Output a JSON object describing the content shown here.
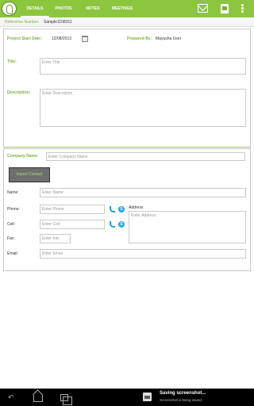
{
  "header": {
    "tabs": [
      {
        "label": "DETAILS",
        "active": true
      },
      {
        "label": "PHOTOS",
        "active": false
      },
      {
        "label": "NOTES",
        "active": false
      },
      {
        "label": "MEETINGS",
        "active": false
      }
    ],
    "icons": [
      "app-logo-icon",
      "mail-icon",
      "document-icon",
      "overflow-menu-icon"
    ]
  },
  "reference": {
    "label": "Reference Number:",
    "value": "Sample1108311"
  },
  "project": {
    "start_date_label": "Project Start Date:",
    "start_date_value": "12/08/2013",
    "prepared_by_label": "Prepared By:",
    "prepared_by_value": "Mayusha User",
    "title_label": "Title:",
    "title_placeholder": "Enter Title",
    "description_label": "Description:",
    "description_placeholder": "Enter Description"
  },
  "contact": {
    "company_label": "Company Name:",
    "company_placeholder": "Enter Company Name",
    "import_button": "Import Contact",
    "name_label": "Name:",
    "name_placeholder": "Enter Name",
    "phone_label": "Phone:",
    "phone_placeholder": "Enter Phone",
    "cell_label": "Cell:",
    "cell_placeholder": "Enter Cell",
    "fax_label": "Fax:",
    "fax_placeholder": "Enter Fax",
    "email_label": "Email:",
    "email_placeholder": "Enter Email",
    "address_label": "Address",
    "address_placeholder": "Enter Address",
    "skype_glyph": "S"
  },
  "notification": {
    "title": "Saving screenshot...",
    "subtitle": "Screenshot is being saved."
  },
  "colors": {
    "accent": "#8cc63f",
    "label_green": "#7cb342",
    "navbar": "#000000"
  }
}
